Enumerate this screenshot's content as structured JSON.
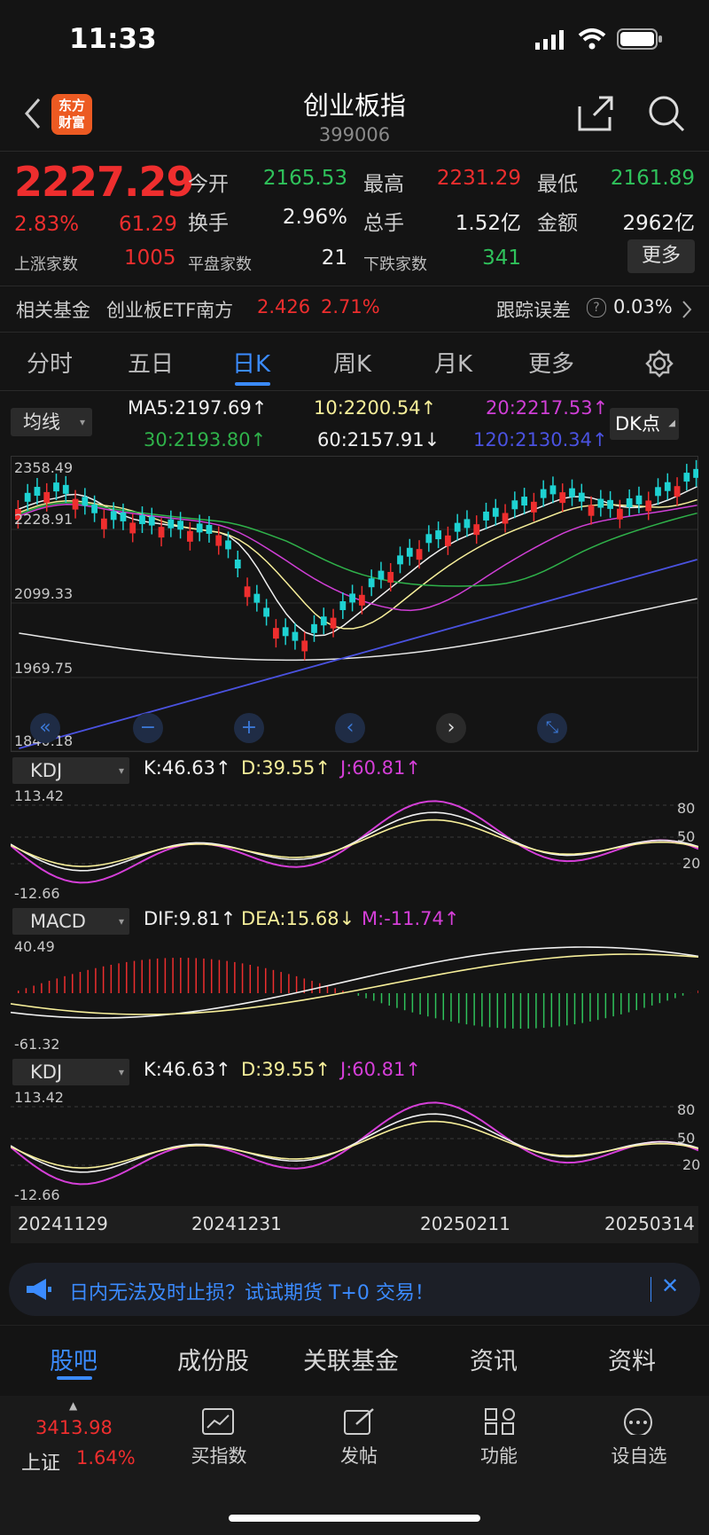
{
  "status_bar": {
    "time": "11:33"
  },
  "header": {
    "title": "创业板指",
    "code": "399006",
    "logo_text_1": "东方",
    "logo_text_2": "财富"
  },
  "quote": {
    "price": "2227.29",
    "change_pct": "2.83%",
    "change": "61.29",
    "open_label": "今开",
    "open": "2165.53",
    "high_label": "最高",
    "high": "2231.29",
    "low_label": "最低",
    "low": "2161.89",
    "turnover_label": "换手",
    "turnover": "2.96%",
    "volume_label": "总手",
    "volume": "1.52亿",
    "amount_label": "金额",
    "amount": "2962亿",
    "up_label": "上涨家数",
    "up": "1005",
    "flat_label": "平盘家数",
    "flat": "21",
    "down_label": "下跌家数",
    "down": "341",
    "more": "更多"
  },
  "fund": {
    "label": "相关基金",
    "name": "创业板ETF南方",
    "price": "2.426",
    "pct": "2.71%",
    "track_label": "跟踪误差",
    "track_value": "0.03%"
  },
  "tabs": [
    "分时",
    "五日",
    "日K",
    "周K",
    "月K",
    "更多"
  ],
  "ma": {
    "button": "均线",
    "dk": "DK点",
    "ma5": "MA5:2197.69↑",
    "ma10": "10:2200.54↑",
    "ma20": "20:2217.53↑",
    "ma30": "30:2193.80↑",
    "ma60": "60:2157.91↓",
    "ma120": "120:2130.34↑"
  },
  "main_axis": [
    "2358.49",
    "2228.91",
    "2099.33",
    "1969.75",
    "1840.18"
  ],
  "kdj": {
    "button": "KDJ",
    "k": "K:46.63↑",
    "d": "D:39.55↑",
    "j": "J:60.81↑",
    "top": "113.42",
    "bottom": "-12.66",
    "l80": "80",
    "l50": "50",
    "l20": "20"
  },
  "macd": {
    "button": "MACD",
    "dif": "DIF:9.81↑",
    "dea": "DEA:15.68↓",
    "m": "M:-11.74↑",
    "top": "40.49",
    "bottom": "-61.32"
  },
  "kdj2": {
    "button": "KDJ",
    "k": "K:46.63↑",
    "d": "D:39.55↑",
    "j": "J:60.81↑",
    "top": "113.42",
    "bottom": "-12.66",
    "l80": "80",
    "l50": "50",
    "l20": "20"
  },
  "dates": [
    "20241129",
    "20241231",
    "20250211",
    "20250314"
  ],
  "ad": {
    "text": "日内无法及时止损？试试期货 T+0 交易！"
  },
  "bottom_tabs": [
    "股吧",
    "成份股",
    "关联基金",
    "资讯",
    "资料"
  ],
  "nav": {
    "index_value": "3413.98",
    "index_name": "上证",
    "index_pct": "1.64%",
    "items": [
      "买指数",
      "发帖",
      "功能",
      "设自选"
    ]
  },
  "colors": {
    "up": "#ee2e2e",
    "down": "#2fc25b",
    "accent": "#3b8bff",
    "bg": "#141414"
  }
}
